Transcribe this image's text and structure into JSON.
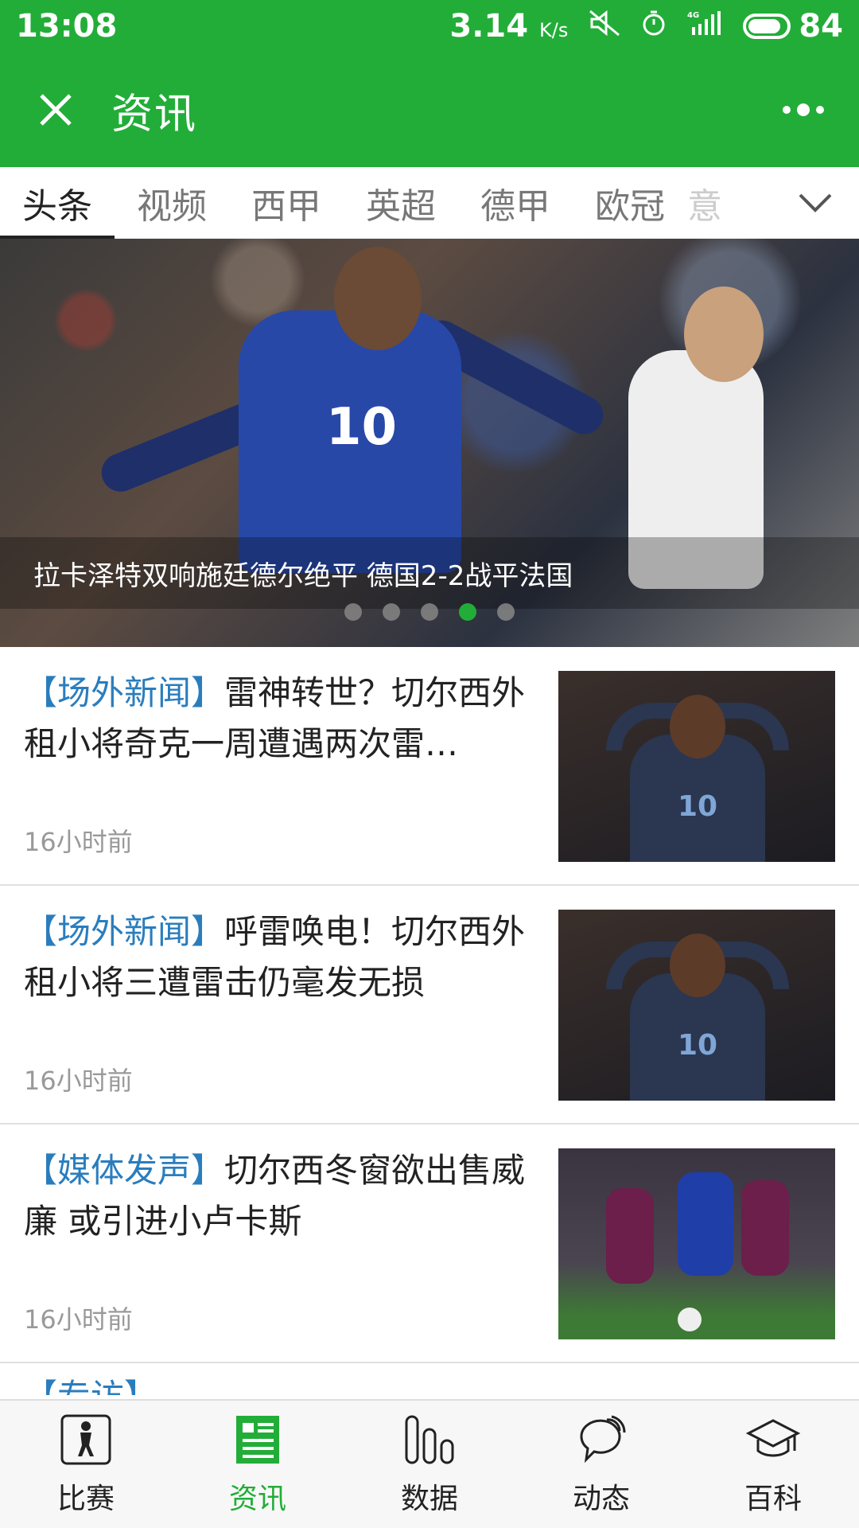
{
  "status_bar": {
    "time": "13:08",
    "speed": "3.14",
    "speed_unit": "K/s",
    "network": "4G",
    "battery": "84"
  },
  "header": {
    "title": "资讯"
  },
  "tabs": [
    {
      "label": "头条",
      "active": true
    },
    {
      "label": "视频"
    },
    {
      "label": "西甲"
    },
    {
      "label": "英超"
    },
    {
      "label": "德甲"
    },
    {
      "label": "欧冠"
    },
    {
      "label": "意"
    }
  ],
  "banner": {
    "caption": "拉卡泽特双响施廷德尔绝平 德国2-2战平法国",
    "jersey_number": "10",
    "indicator_count": 5,
    "active_indicator": 4
  },
  "news": [
    {
      "tag": "【场外新闻】",
      "title": "雷神转世？切尔西外租小将奇克一周遭遇两次雷…",
      "time": "16小时前"
    },
    {
      "tag": "【场外新闻】",
      "title": "呼雷唤电！切尔西外租小将三遭雷击仍毫发无损",
      "time": "16小时前"
    },
    {
      "tag": "【媒体发声】",
      "title": "切尔西冬窗欲出售威廉 或引进小卢卡斯",
      "time": "16小时前"
    },
    {
      "tag": "【专访】",
      "title": "",
      "time": ""
    }
  ],
  "bottom_nav": [
    {
      "label": "比赛",
      "icon": "player-icon"
    },
    {
      "label": "资讯",
      "icon": "news-icon",
      "active": true
    },
    {
      "label": "数据",
      "icon": "chart-icon"
    },
    {
      "label": "动态",
      "icon": "chat-bubble-icon"
    },
    {
      "label": "百科",
      "icon": "graduation-cap-icon"
    }
  ],
  "colors": {
    "brand_green": "#22ad38",
    "tag_blue": "#2a7dbd"
  }
}
